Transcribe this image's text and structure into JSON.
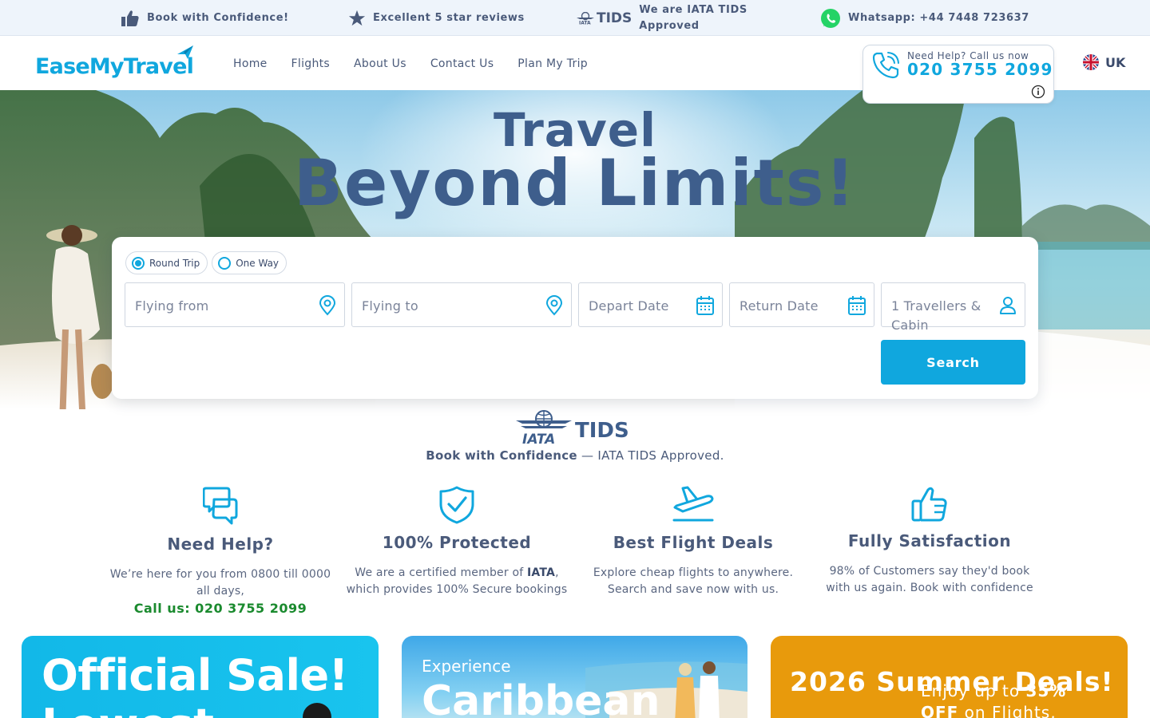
{
  "topbar": {
    "confidence": "Book with Confidence!",
    "reviews": "Excellent 5 star reviews",
    "tids_brand": "TIDS",
    "tids_line1": "We are IATA TIDS",
    "tids_line2": "Approved",
    "whatsapp": "Whatsapp: +44 7448 723637"
  },
  "header": {
    "logo_text": "EaseMyTravel",
    "nav": [
      "Home",
      "Flights",
      "About Us",
      "Contact Us",
      "Plan My Trip"
    ],
    "help_label": "Need Help? Call us now",
    "help_number": "020 3755 2099",
    "region": "UK"
  },
  "hero": {
    "title_line1": "Travel",
    "title_line2": "Beyond Limits!"
  },
  "search": {
    "trip_types": [
      {
        "label": "Round Trip",
        "selected": true
      },
      {
        "label": "One Way",
        "selected": false
      }
    ],
    "flying_from": "Flying from",
    "flying_to": "Flying to",
    "depart_date": "Depart Date",
    "return_date": "Return Date",
    "travellers": "1 Travellers & Cabin",
    "search_button": "Search"
  },
  "tids": {
    "iata": "IATA",
    "tids": "TIDS",
    "caption_bold": "Book with Confidence",
    "caption_rest": " — IATA TIDS Approved."
  },
  "features": [
    {
      "icon": "chat-bubbles-icon",
      "title": "Need Help?",
      "text": "We’re here for you from 0800 till 0000 all days,",
      "call": "Call us: 020 3755 2099"
    },
    {
      "icon": "shield-check-icon",
      "title": "100% Protected",
      "text_before": "We are a certified member of ",
      "text_bold": "IATA",
      "text_after": ", which provides 100% Secure bookings"
    },
    {
      "icon": "plane-takeoff-icon",
      "title": "Best Flight Deals",
      "text": "Explore cheap flights to anywhere. Search and save now with us."
    },
    {
      "icon": "thumbs-up-icon",
      "title": "Fully Satisfaction",
      "text": "98% of Customers say they'd book with us again. Book with confidence"
    }
  ],
  "promos": {
    "promo1_title": "Official Sale!",
    "promo1_sub": "Lowest",
    "promo2_kicker": "Experience",
    "promo2_title": "Caribbean",
    "promo3_title": "2026 Summer Deals!",
    "promo3_offer_prefix": "Enjoy up to ",
    "promo3_offer_value": "35%",
    "promo3_offer_line2_bold": "OFF",
    "promo3_offer_line2_rest": " on Flights,"
  },
  "colors": {
    "brand_blue": "#10a7de",
    "heading_navy": "#3e5e8c",
    "call_green": "#1a8a2e",
    "promo_orange": "#e89a0c"
  }
}
